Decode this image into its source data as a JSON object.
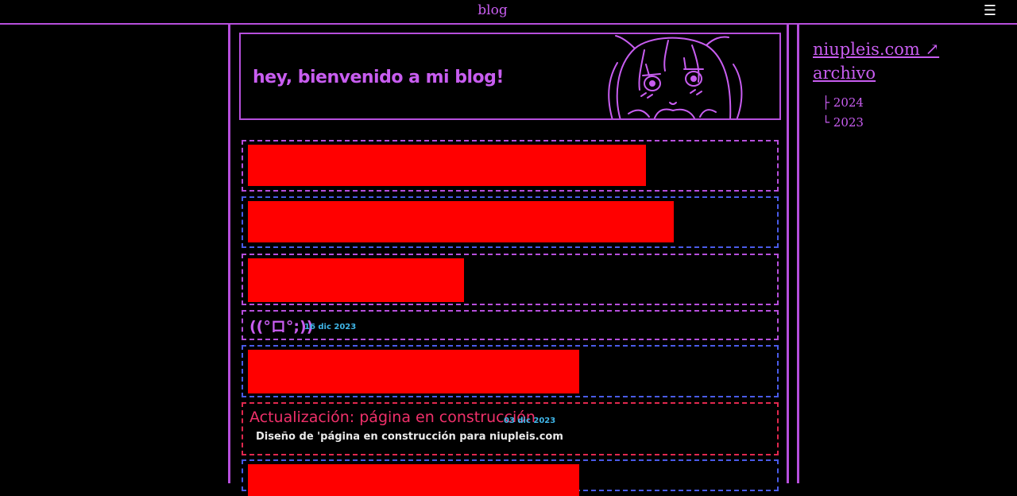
{
  "topbar": {
    "title": "blog",
    "menu_icon": "☰"
  },
  "banner": {
    "welcome": "hey, bienvenido a mi blog!"
  },
  "posts": [
    {
      "kaomoji": "((°ロ°;))",
      "date": "16 dic 2023"
    },
    {
      "title": "Actualización: página en construcción",
      "date": "03 dic 2023",
      "body": "Diseño de 'página en construcción para niupleis.com"
    }
  ],
  "sidebar": {
    "site_link": "niupleis.com ↗",
    "archive_label": "archivo",
    "years": [
      "├ 2024",
      "└ 2023"
    ]
  },
  "colors": {
    "accent": "#b64fdc",
    "accent_text": "#c85df0",
    "post_title": "#f0306a",
    "date": "#3fb6e8",
    "redacted": "#ff0000"
  }
}
